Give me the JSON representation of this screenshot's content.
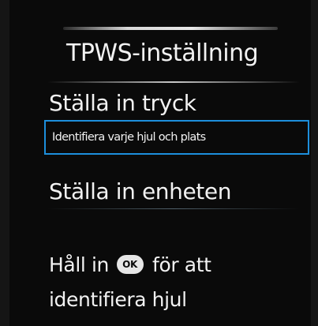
{
  "screen": {
    "title": "TPWS-inställning",
    "menu": [
      {
        "label": "Ställa in tryck",
        "selected": false
      },
      {
        "label": "Identifiera varje hjul och plats",
        "selected": true
      },
      {
        "label": "Ställa in enheten",
        "selected": false
      }
    ],
    "hint": {
      "before_icon": "Håll in",
      "icon": "OK",
      "after_icon": "för att",
      "line2": "identifiera hjul"
    }
  },
  "colors": {
    "selection_border": "#1d8fdc",
    "background": "#0a0a0a",
    "text": "#f2f2f2"
  },
  "icons": {
    "ok": "ok-button-icon"
  }
}
